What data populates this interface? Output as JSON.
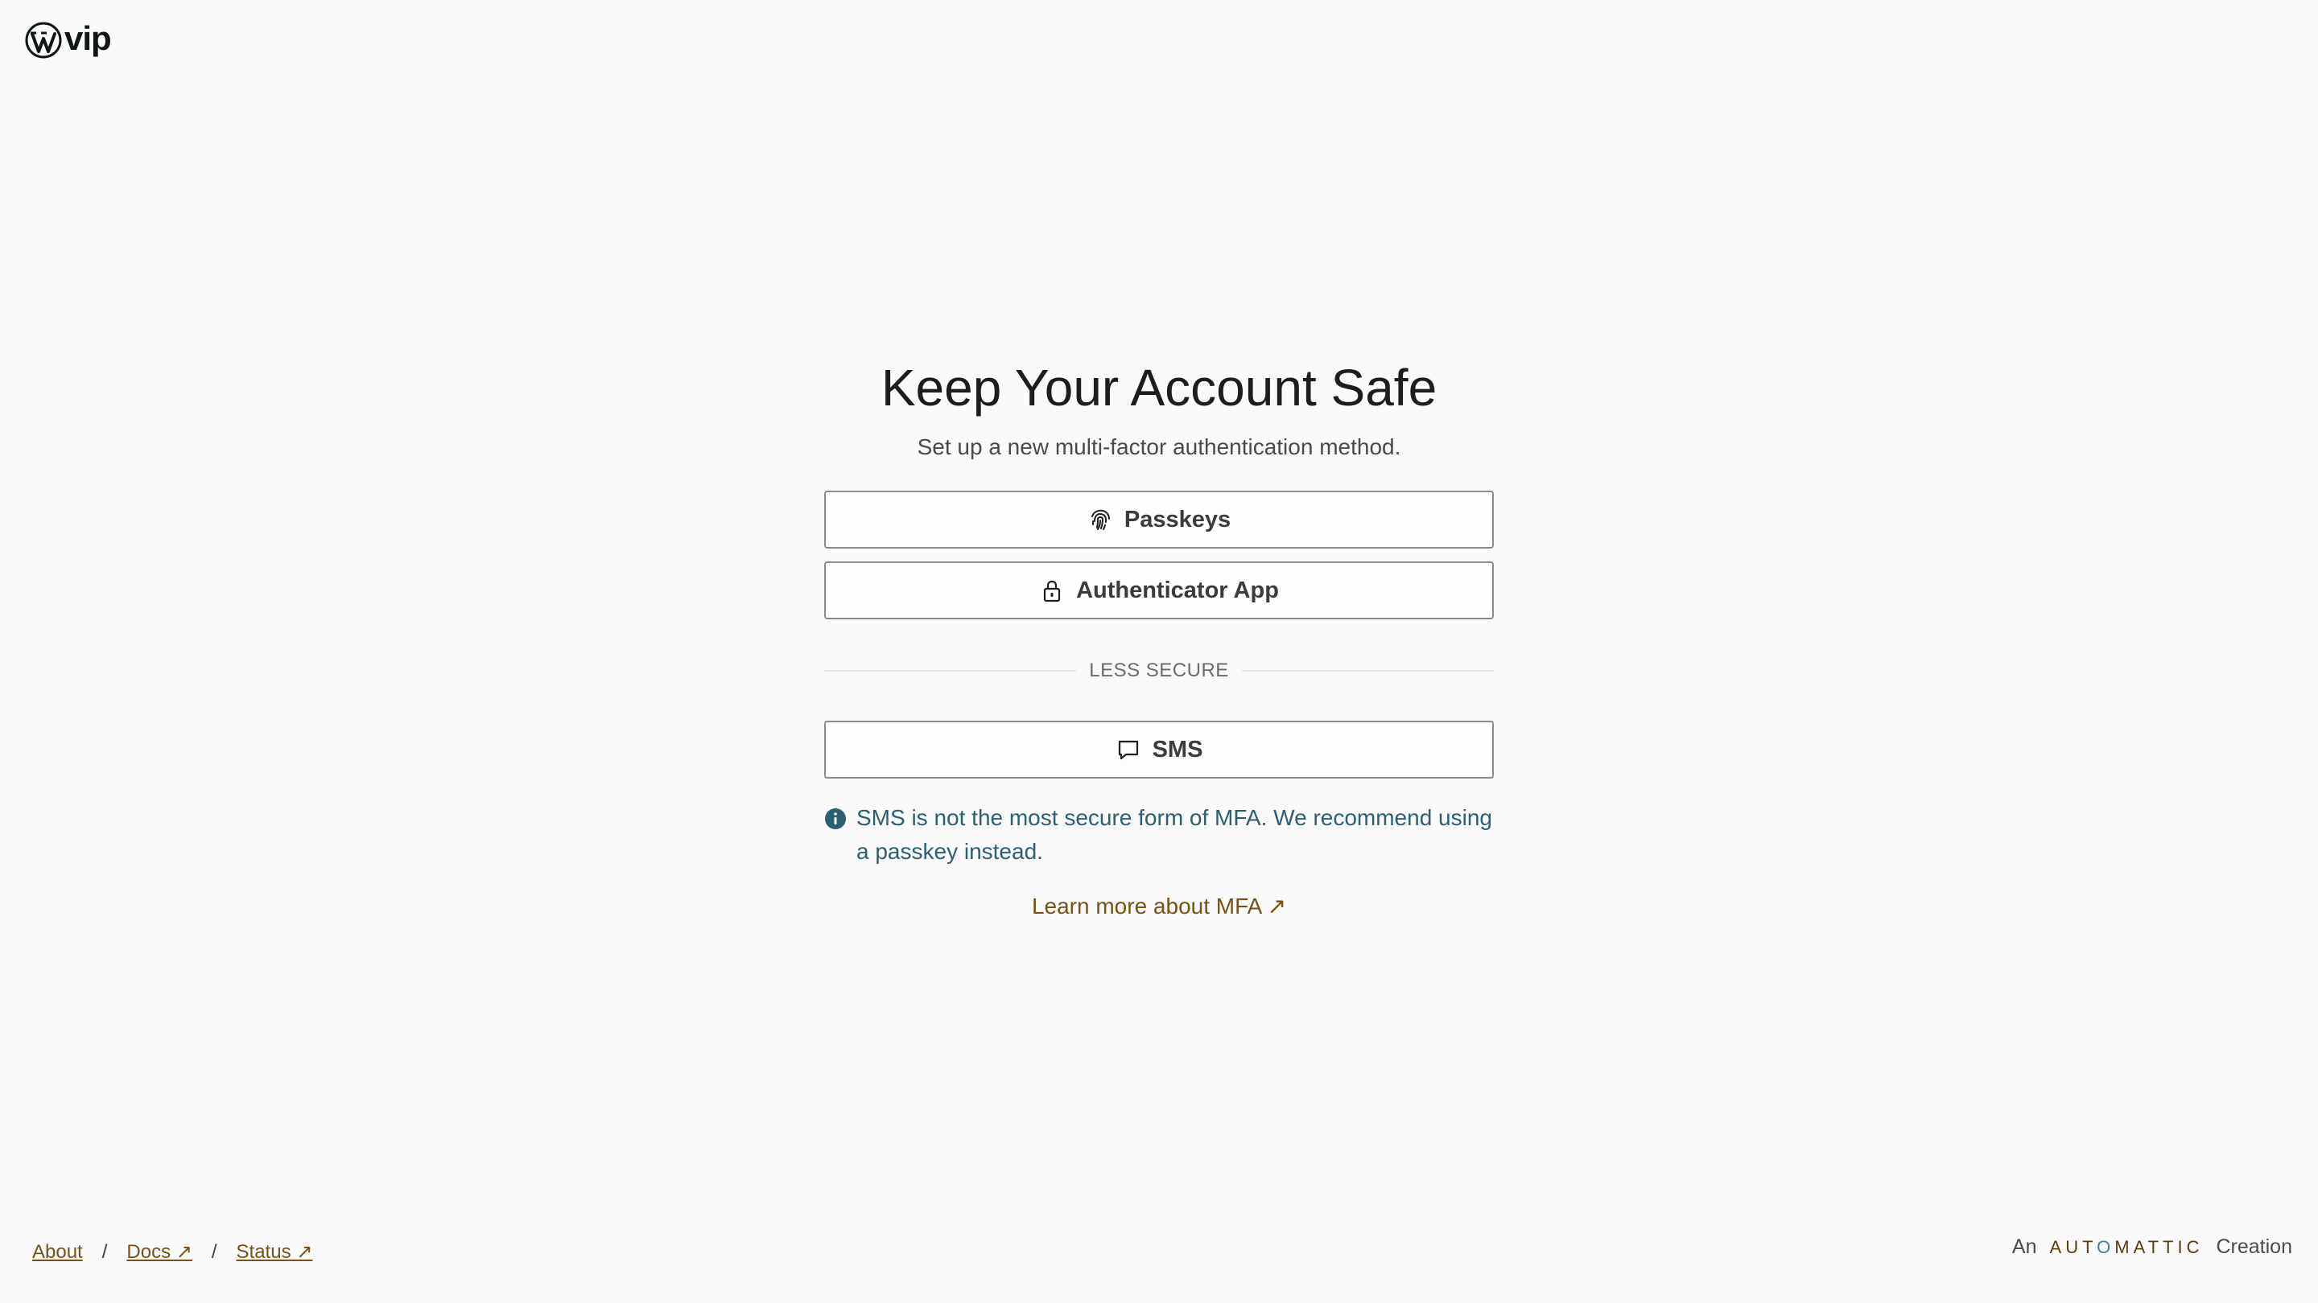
{
  "brand": {
    "logo_text": "vip"
  },
  "main": {
    "title": "Keep Your Account Safe",
    "subtitle": "Set up a new multi-factor authentication method.",
    "options": {
      "passkeys": {
        "label": "Passkeys",
        "icon": "fingerprint-icon"
      },
      "authenticator": {
        "label": "Authenticator App",
        "icon": "lock-icon"
      },
      "sms": {
        "label": "SMS",
        "icon": "chat-bubble-icon"
      }
    },
    "divider_label": "LESS SECURE",
    "sms_notice": "SMS is not the most secure form of MFA. We recommend using a passkey instead.",
    "learn_more": "Learn more about MFA ↗"
  },
  "footer": {
    "links": {
      "about": "About",
      "docs": "Docs ↗",
      "status": "Status ↗"
    },
    "separator": "/",
    "credit_prefix": "An",
    "credit_brand_a": "AUT",
    "credit_brand_o": "O",
    "credit_brand_b": "MATTIC",
    "credit_suffix": "Creation"
  },
  "colors": {
    "background": "#fafafa",
    "link": "#7a5015",
    "notice": "#2d5f73",
    "button_border": "#8a8a8a"
  }
}
